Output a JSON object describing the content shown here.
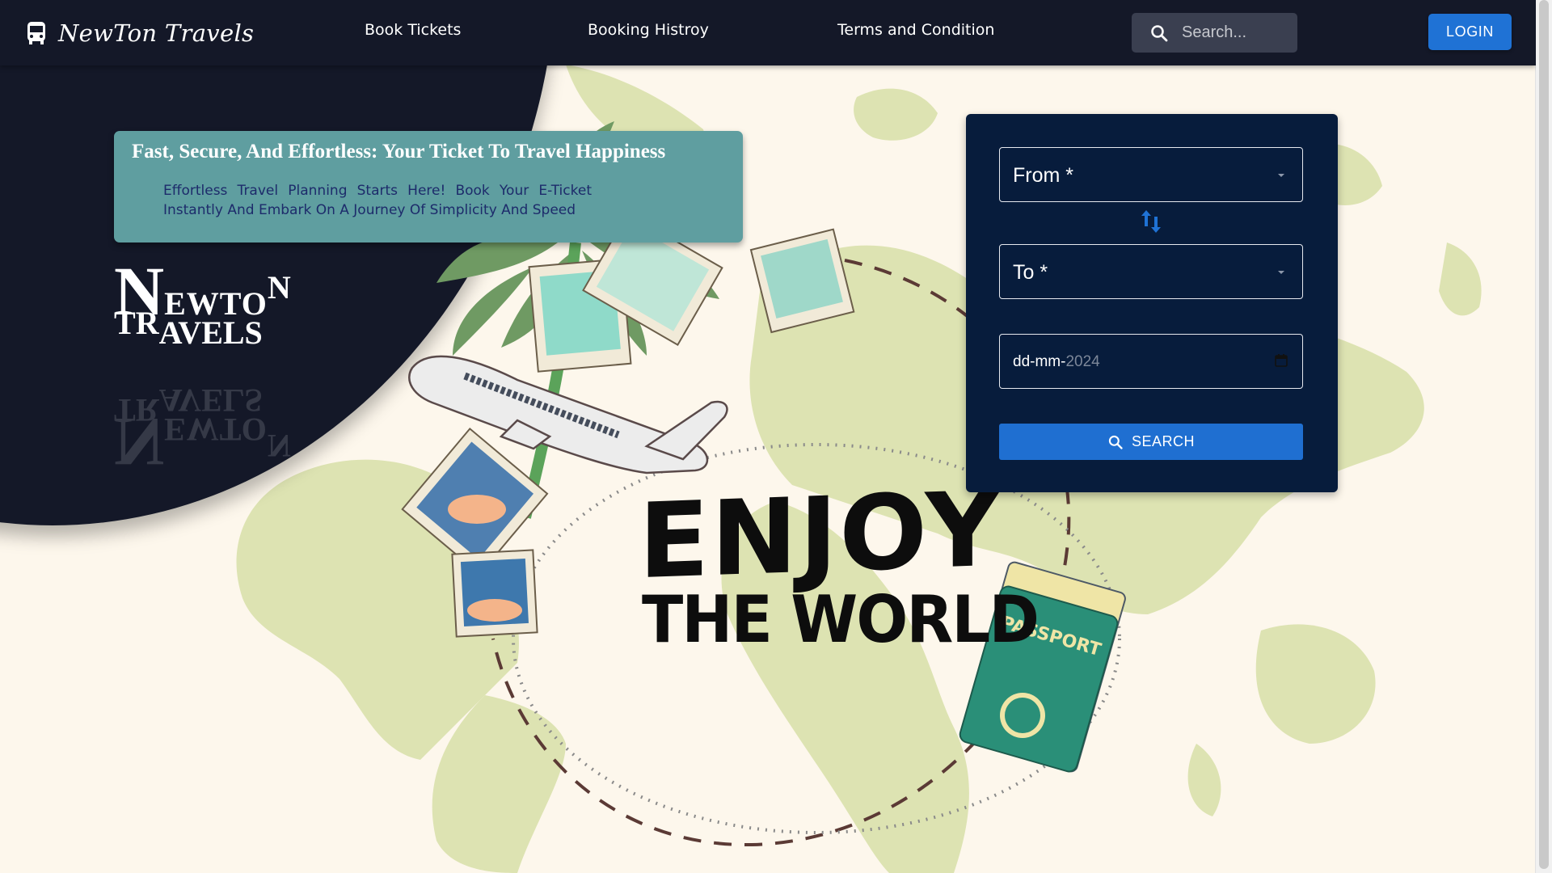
{
  "navbar": {
    "brand": "NewTon Travels",
    "links": [
      "Book Tickets",
      "Booking Histroy",
      "Terms and Condition"
    ],
    "search_placeholder": "Search...",
    "login_label": "LOGIN"
  },
  "hero": {
    "tagline_title": "Fast, Secure, And Effortless: Your Ticket To Travel Happiness",
    "tagline_text": "Effortless Travel Planning Starts Here! Book Your E-Ticket Instantly And Embark On A Journey Of Simplicity And Speed",
    "logo": {
      "line1_cap": "N",
      "line1_rest": "EWTO",
      "line1_end": "N",
      "line2_cap": "T",
      "line2_mid": "R",
      "line2_rest": "AVELS"
    },
    "enjoy_line1": "ENJOY",
    "enjoy_line2": "THE WORLD",
    "passport_text": "PASSPORT"
  },
  "booking": {
    "from_label": "From *",
    "to_label": "To *",
    "date_prefix": "dd-mm-",
    "date_year": "2024",
    "search_label": "SEARCH"
  },
  "colors": {
    "navbar": "#141828",
    "accent": "#1f72d5",
    "panel": "#071c3c",
    "tagline_card": "#5f9ea0",
    "map_land": "#dde3b2",
    "background": "#fdf7ec"
  }
}
